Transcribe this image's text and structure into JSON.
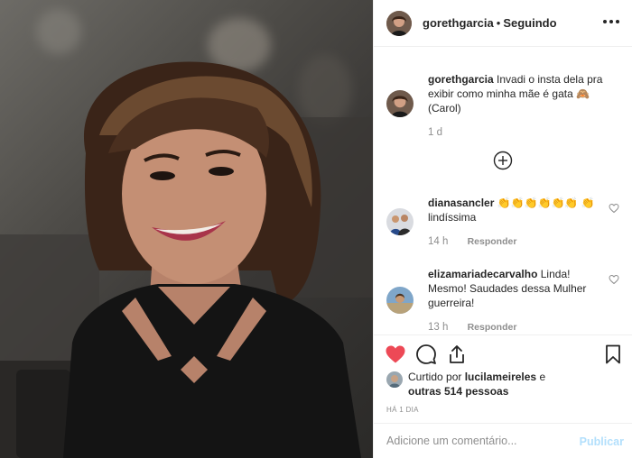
{
  "colors": {
    "link": "#262626",
    "muted": "#8e8e8e",
    "liked": "#ed4956",
    "publish_disabled": "#b2dffc",
    "border": "#efefef"
  },
  "header": {
    "username": "gorethgarcia",
    "separator": "•",
    "follow_status": "Seguindo",
    "more_icon": "more-horizontal-icon"
  },
  "caption": {
    "username": "gorethgarcia",
    "text": "Invadi o insta dela pra exibir como minha mãe é gata 🙈 (Carol)",
    "time": "1 d"
  },
  "load_more_icon": "plus-circle-icon",
  "comments": [
    {
      "username": "dianasancler",
      "text": "👏👏👏👏👏👏 👏 lindíssima",
      "time": "14 h",
      "reply": "Responder"
    },
    {
      "username": "elizamariadecarvalho",
      "text": "Linda! Mesmo! Saudades dessa Mulher guerreira!",
      "time": "13 h",
      "reply": "Responder"
    }
  ],
  "actions": {
    "like_icon": "heart-filled-icon",
    "comment_icon": "comment-icon",
    "share_icon": "share-icon",
    "save_icon": "bookmark-icon"
  },
  "likes": {
    "prefix": "Curtido por",
    "user": "lucilameireles",
    "conjunction": "e",
    "others": "outras 514 pessoas"
  },
  "date": "HÁ 1 DIA",
  "add_comment": {
    "placeholder": "Adicione um comentário...",
    "publish": "Publicar"
  }
}
